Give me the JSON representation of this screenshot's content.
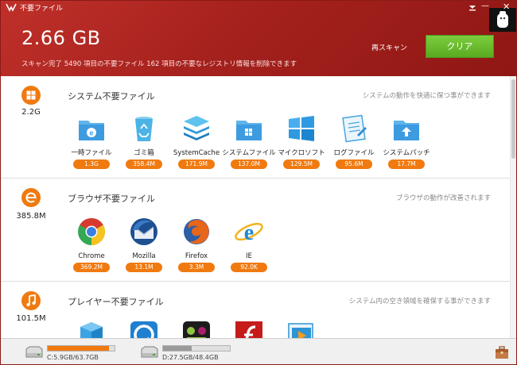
{
  "app": {
    "title": "不要ファイル",
    "total_size": "2.66 GB",
    "scan_summary": "スキャン完了 5490 項目の不要ファイル 162 項目の不要なレジストリ情報を削除できます",
    "rescan_label": "再スキャン",
    "clean_label": "クリア"
  },
  "sections": [
    {
      "size": "2.2G",
      "icon": "windows-icon",
      "title": "システム不要ファイル",
      "description": "システムの動作を快適に保つ事ができます",
      "items": [
        {
          "label": "一時ファイル",
          "size": "1.3G",
          "icon": "temp-folder-icon"
        },
        {
          "label": "ゴミ箱",
          "size": "358.4M",
          "icon": "recycle-bin-icon"
        },
        {
          "label": "SystemCache",
          "size": "171.9M",
          "icon": "system-cache-icon"
        },
        {
          "label": "システムファイル",
          "size": "137.0M",
          "icon": "system-folder-icon"
        },
        {
          "label": "マイクロソフト",
          "size": "129.5M",
          "icon": "microsoft-icon"
        },
        {
          "label": "ログファイル",
          "size": "95.6M",
          "icon": "log-file-icon"
        },
        {
          "label": "システムパッチ",
          "size": "17.7M",
          "icon": "system-patch-icon"
        }
      ]
    },
    {
      "size": "385.8M",
      "icon": "browser-icon",
      "title": "ブラウザ不要ファイル",
      "description": "ブラウザの動作が改善されます",
      "items": [
        {
          "label": "Chrome",
          "size": "369.2M",
          "icon": "chrome-icon"
        },
        {
          "label": "Mozilla",
          "size": "13.1M",
          "icon": "thunderbird-icon"
        },
        {
          "label": "Firefox",
          "size": "3.3M",
          "icon": "firefox-icon"
        },
        {
          "label": "IE",
          "size": "92.0K",
          "icon": "ie-icon"
        }
      ]
    },
    {
      "size": "101.5M",
      "icon": "music-icon",
      "title": "プレイヤー不要ファイル",
      "description": "システム内の空き領域を確保する事ができます",
      "items": [
        {
          "icon": "player-box-icon"
        },
        {
          "icon": "quicktime-icon"
        },
        {
          "icon": "media-player-icon"
        },
        {
          "icon": "flash-icon"
        },
        {
          "icon": "video-player-icon"
        }
      ]
    }
  ],
  "drives": [
    {
      "label": "C:5.9GB/63.7GB",
      "used_fraction": 0.92,
      "fill_color": "#f07a10"
    },
    {
      "label": "D:27.5GB/48.4GB",
      "used_fraction": 0.43,
      "fill_color": "#9a9a9a"
    }
  ],
  "colors": {
    "header_red": "#b0241f",
    "accent_orange": "#f07a10",
    "clean_green": "#62b32a"
  }
}
